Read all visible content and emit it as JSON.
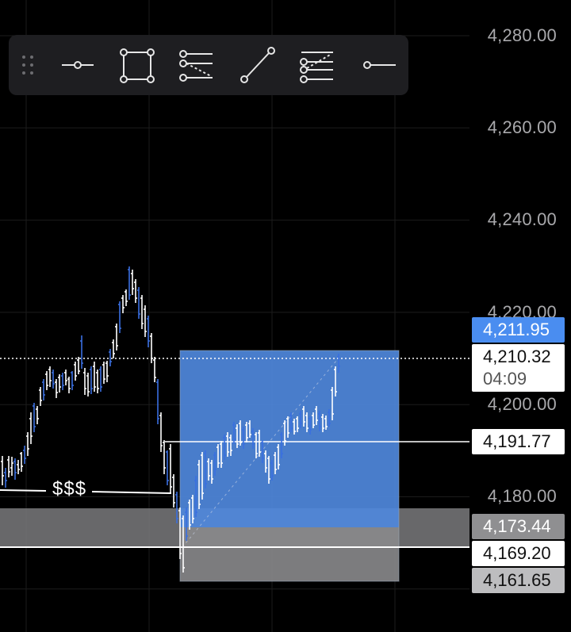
{
  "toolbar": {
    "tools": [
      {
        "name": "horizontal-ray-tool-icon"
      },
      {
        "name": "rectangle-tool-icon"
      },
      {
        "name": "short-position-tool-icon"
      },
      {
        "name": "trend-line-tool-icon"
      },
      {
        "name": "long-position-tool-icon"
      },
      {
        "name": "horizontal-line-tool-icon"
      }
    ]
  },
  "price_axis": {
    "labels": [
      "4,280.00",
      "4,260.00",
      "4,240.00",
      "4,220.00",
      "4,200.00",
      "4,180.00"
    ],
    "values": [
      4280,
      4260,
      4240,
      4220,
      4200,
      4180
    ]
  },
  "price_tags": {
    "target": "4,211.95",
    "current": "4,210.32",
    "countdown": "04:09",
    "entry": "4,191.77",
    "stop": "4,173.44",
    "level": "4,169.20",
    "low": "4,161.65"
  },
  "annotation": {
    "liquidity_label": "$$$"
  },
  "colors": {
    "profit_zone": "#4f88dc",
    "loss_zone": "#7a7a7c",
    "up_candle": "#ffffff",
    "down_candle": "#3a6fe0",
    "grid": "#1c1c1c"
  }
}
